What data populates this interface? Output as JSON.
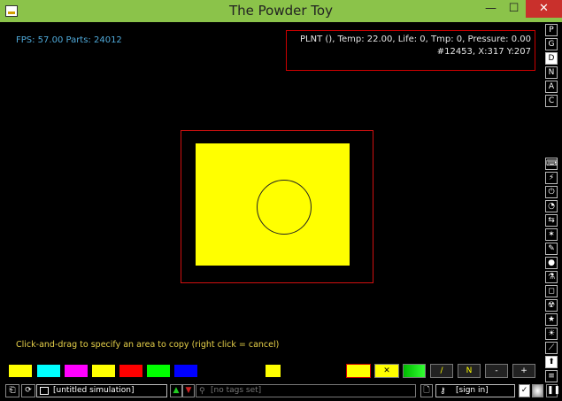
{
  "window": {
    "title": "The Powder Toy",
    "minimize": "—",
    "maximize": "☐",
    "close": "✕"
  },
  "hud": {
    "fps_text": "FPS: 57.00 Parts: 24012",
    "info_line1": "PLNT (), Temp: 22.00, Life: 0, Tmp: 0, Pressure: 0.00",
    "info_line2": "#12453, X:317 Y:207",
    "hint": "Click-and-drag to specify an area to copy (right click = cancel)"
  },
  "right_toolbar_top": [
    "P",
    "G",
    "D",
    "N",
    "A",
    "C"
  ],
  "right_toolbar_icons": [
    "keyboard-icon",
    "plug-icon",
    "power-icon",
    "gauge-icon",
    "arrows-icon",
    "sparkle-icon",
    "pen-icon",
    "drop-icon",
    "flask-icon",
    "square-icon",
    "radiation-icon",
    "star-icon",
    "bulb-icon",
    "wand-icon",
    "cursor-icon"
  ],
  "palette": {
    "swatches": [
      "#ffff00",
      "#00ffff",
      "#ff00ff",
      "#ffff00",
      "#ff0000",
      "#00ff00",
      "#0000ff"
    ],
    "selected_swatch": "#ffff00",
    "tool_labels": [
      "/",
      "N",
      "-",
      "+"
    ]
  },
  "bottom": {
    "sim_name": "[untitled simulation]",
    "tags_placeholder": "[no tags set]",
    "sign_in": "[sign in]"
  },
  "colors": {
    "titlebar": "#8bc34a",
    "accent_red": "#d01010",
    "hud_blue": "#4fa9d9",
    "hint_yellow": "#e8d24a"
  }
}
